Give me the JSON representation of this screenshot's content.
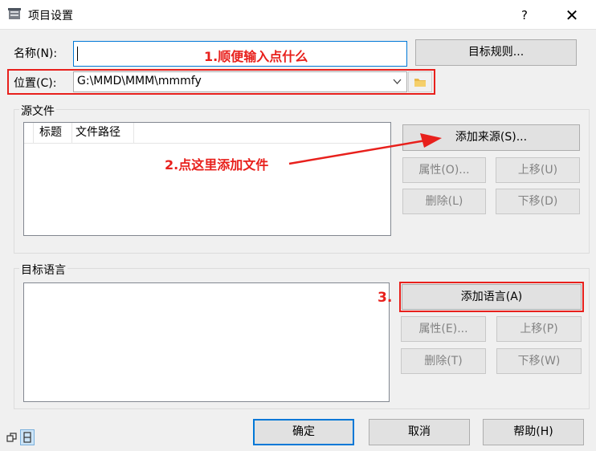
{
  "window": {
    "title": "项目设置",
    "help_label": "?",
    "close_label": "✕"
  },
  "form": {
    "name_label": "名称(N):",
    "name_value": "",
    "target_rules_button": "目标规则...",
    "location_label": "位置(C):",
    "location_value": "G:\\MMD\\MMM\\mmmfy"
  },
  "source_files": {
    "group_title": "源文件",
    "columns": [
      "标题",
      "文件路径"
    ],
    "add_source_button": "添加来源(S)...",
    "properties_button": "属性(O)...",
    "move_up_button": "上移(U)",
    "delete_button": "删除(L)",
    "move_down_button": "下移(D)"
  },
  "target_language": {
    "group_title": "目标语言",
    "add_language_button": "添加语言(A)",
    "properties_button": "属性(E)...",
    "move_up_button": "上移(P)",
    "delete_button": "删除(T)",
    "move_down_button": "下移(W)"
  },
  "footer": {
    "ok_button": "确定",
    "cancel_button": "取消",
    "help_button": "帮助(H)"
  },
  "annotations": {
    "step1": "1.顺便输入点什么",
    "step2": "2.点这里添加文件",
    "step3": "3."
  },
  "colors": {
    "annotation_red": "#e8201c",
    "focus_blue": "#0078d7"
  }
}
